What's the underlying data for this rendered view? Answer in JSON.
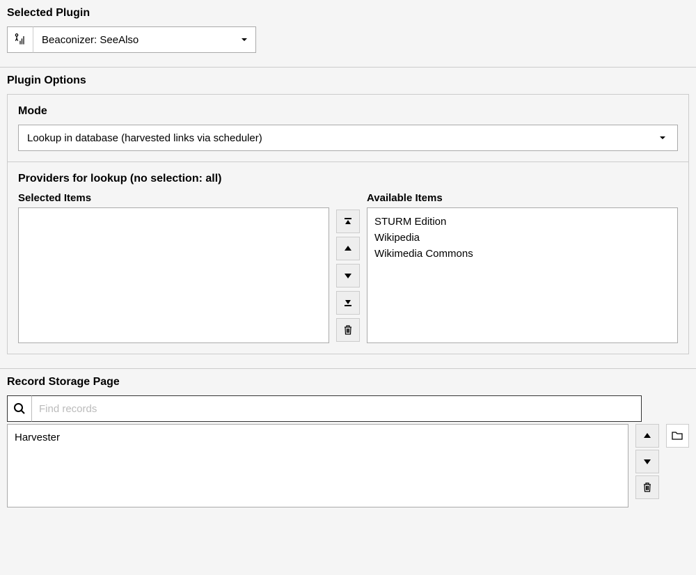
{
  "selected_plugin": {
    "title": "Selected Plugin",
    "value": "Beaconizer: SeeAlso"
  },
  "plugin_options": {
    "title": "Plugin Options",
    "mode": {
      "label": "Mode",
      "value": "Lookup in database (harvested links via scheduler)"
    },
    "providers": {
      "label": "Providers for lookup (no selection: all)",
      "selected_label": "Selected Items",
      "available_label": "Available Items",
      "available_items": [
        "STURM Edition",
        "Wikipedia",
        "Wikimedia Commons"
      ]
    }
  },
  "record_storage": {
    "title": "Record Storage Page",
    "search_placeholder": "Find records",
    "items": [
      "Harvester"
    ]
  }
}
